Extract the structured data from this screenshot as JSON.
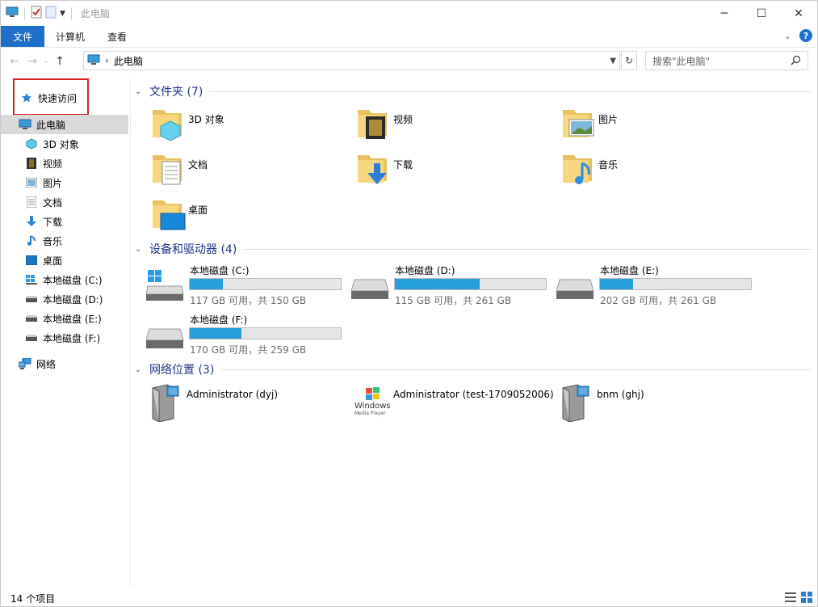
{
  "window": {
    "title": "此电脑"
  },
  "ribbon": {
    "file": "文件",
    "computer": "计算机",
    "view": "查看"
  },
  "address": {
    "crumb": "此电脑",
    "search_placeholder": "搜索\"此电脑\""
  },
  "sidebar": {
    "quick_access": "快速访问",
    "this_pc": "此电脑",
    "items": [
      "3D 对象",
      "视频",
      "图片",
      "文档",
      "下载",
      "音乐",
      "桌面",
      "本地磁盘 (C:)",
      "本地磁盘 (D:)",
      "本地磁盘 (E:)",
      "本地磁盘 (F:)"
    ],
    "network": "网络"
  },
  "groups": {
    "folders": {
      "title": "文件夹 (7)",
      "items": [
        "3D 对象",
        "视频",
        "图片",
        "文档",
        "下载",
        "音乐",
        "桌面"
      ]
    },
    "drives": {
      "title": "设备和驱动器 (4)",
      "items": [
        {
          "name": "本地磁盘 (C:)",
          "free": "117 GB 可用，共 150 GB",
          "used_fraction": 0.22
        },
        {
          "name": "本地磁盘 (D:)",
          "free": "115 GB 可用，共 261 GB",
          "used_fraction": 0.56
        },
        {
          "name": "本地磁盘 (E:)",
          "free": "202 GB 可用，共 261 GB",
          "used_fraction": 0.22
        },
        {
          "name": "本地磁盘 (F:)",
          "free": "170 GB 可用，共 259 GB",
          "used_fraction": 0.34
        }
      ]
    },
    "network": {
      "title": "网络位置 (3)",
      "items": [
        "Administrator (dyj)",
        "Administrator (test-1709052006)",
        "bnm (ghj)"
      ],
      "wmp_logo_text": "Windows",
      "wmp_logo_sub": "Media Player"
    }
  },
  "status": {
    "count": "14 个项目"
  },
  "colors": {
    "accent": "#1e6fc9",
    "drive_bar": "#26a0da",
    "group_title": "#1e3287",
    "highlight": "#e02020"
  }
}
